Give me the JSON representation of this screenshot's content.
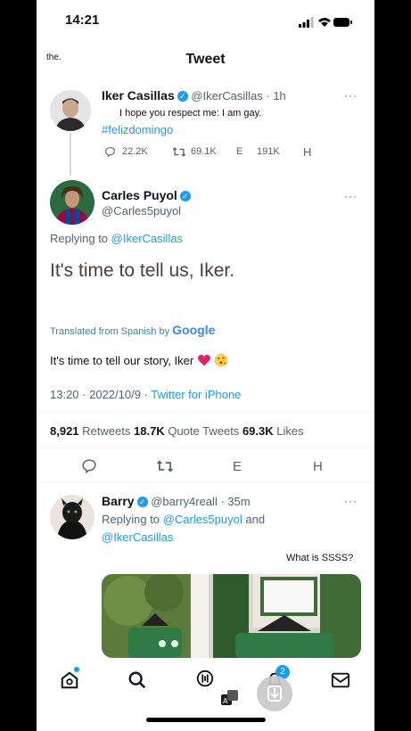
{
  "status": {
    "time": "14:21"
  },
  "header": {
    "left_text": "the.",
    "title": "Tweet"
  },
  "tweet1": {
    "name": "Iker Casillas",
    "handle": "@IkerCasillas",
    "age": "· 1h",
    "text": "I hope you respect me: I am gay.",
    "hashtag": "#felizdomingo",
    "replies": "22.2K",
    "retweets": "69.1K",
    "e_label": "E",
    "likes": "191K",
    "h_label": "H",
    "more": "···"
  },
  "tweet2": {
    "name": "Carles Puyol",
    "handle": "@Carles5puyol",
    "replying_prefix": "Replying to",
    "replying_to": "@IkerCasillas",
    "text": "It's time to tell us, Iker.",
    "translated_label": "Translated from Spanish by",
    "google": "Google",
    "translation": "It's time to tell our story, Iker",
    "timestamp": "13:20 · 2022/10/9 ·",
    "source": "Twitter for iPhone",
    "retweets_count": "8,921",
    "retweets_label": "Retweets",
    "quotes_count": "18.7K",
    "quotes_label": "Quote Tweets",
    "likes_count": "69.3K",
    "likes_label": "Likes",
    "action_e": "E",
    "action_h": "H",
    "more": "···"
  },
  "tweet3": {
    "name": "Barry",
    "handle": "@barry4reall",
    "age": "· 35m",
    "replying_prefix": "Replying to",
    "replying_to_1": "@Carles5puyol",
    "replying_and": "and",
    "replying_to_2": "@IkerCasillas",
    "text": "What is SSSS?",
    "more": "···"
  },
  "tabbar": {
    "notifications_badge": "2"
  },
  "colors": {
    "accent": "#1d9bf0",
    "heart": "#e0245e",
    "text": "#0f1419",
    "muted": "#536471"
  },
  "icons": [
    "home-icon",
    "search-icon",
    "spaces-icon",
    "notifications-icon",
    "messages-icon",
    "translate-icon",
    "download-icon",
    "reply-icon",
    "retweet-icon",
    "verified-icon",
    "heart-emoji",
    "kiss-emoji"
  ]
}
